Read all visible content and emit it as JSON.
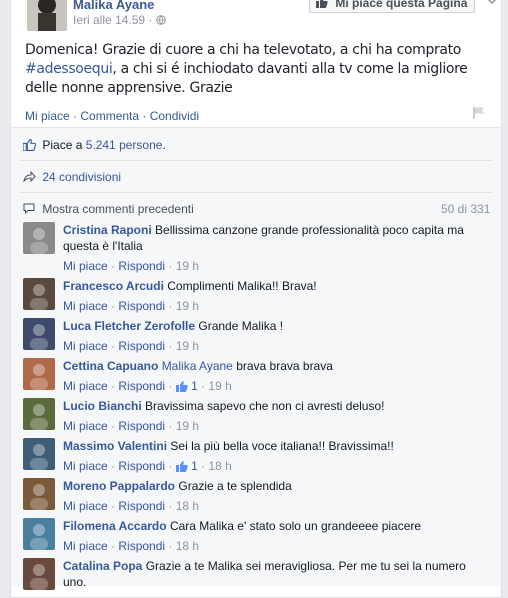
{
  "post": {
    "page_name": "Malika Ayane",
    "time": "Ieri alle 14.59 · ",
    "like_page_button": "Mi piace questa Pagina",
    "text_before": "Domenica! Grazie di cuore a chi ha televotato, a chi ha comprato ",
    "hashtag": "#adessoequi",
    "text_after": ", a chi si é inchiodato davanti alla tv come la migliore delle nonne apprensive. Grazie",
    "actions": {
      "like": "Mi piace",
      "comment": "Commenta",
      "share": "Condividi",
      "sep": " · "
    }
  },
  "stats": {
    "likes_prefix": "Piace a ",
    "likes_count": "5.241 persone",
    "likes_suffix": ".",
    "shares": "24 condivisioni",
    "previous_comments": "Mostra commenti precedenti",
    "comments_counter": "50 di 331"
  },
  "comment_meta": {
    "like": "Mi piace",
    "reply": "Rispondi",
    "sep": " · "
  },
  "comments": [
    {
      "name": "Cristina Raponi",
      "text": "Bellissima canzone grande professionalità poco capita ma questa è l'Italia",
      "likes": "",
      "time": "19 h",
      "avatar_color": "#8a8a8a"
    },
    {
      "name": "Francesco Arcudi",
      "text": "Complimenti Malika!! Brava!",
      "likes": "",
      "time": "19 h",
      "avatar_color": "#5a4a3e"
    },
    {
      "name": "Luca Fletcher Zerofolle",
      "text": "Grande Malika !",
      "likes": "",
      "time": "19 h",
      "avatar_color": "#3d4a6b"
    },
    {
      "name": "Cettina Capuano",
      "text": "brava brava brava",
      "mention": "Malika Ayane",
      "likes": "1",
      "time": "19 h",
      "avatar_color": "#b06a4a"
    },
    {
      "name": "Lucio Bianchi",
      "text": "Bravissima sapevo che non ci avresti deluso!",
      "likes": "",
      "time": "19 h",
      "avatar_color": "#5b6b3e"
    },
    {
      "name": "Massimo Valentini",
      "text": "Sei la più bella voce italiana!! Bravissima!!",
      "likes": "1",
      "time": "18 h",
      "avatar_color": "#3e5e78"
    },
    {
      "name": "Moreno Pappalardo",
      "text": "Grazie a te splendida",
      "likes": "",
      "time": "18 h",
      "avatar_color": "#7a5a3a"
    },
    {
      "name": "Filomena Accardo",
      "text": "Cara Malika e' stato solo un grandeeee piacere",
      "likes": "",
      "time": "18 h",
      "avatar_color": "#4a7fa0"
    },
    {
      "name": "Catalina Popa",
      "text": "Grazie a te Malika sei meravigliosa. Per me tu sei la numero uno.",
      "likes": "",
      "time": "",
      "avatar_color": "#6b4a3e"
    }
  ]
}
